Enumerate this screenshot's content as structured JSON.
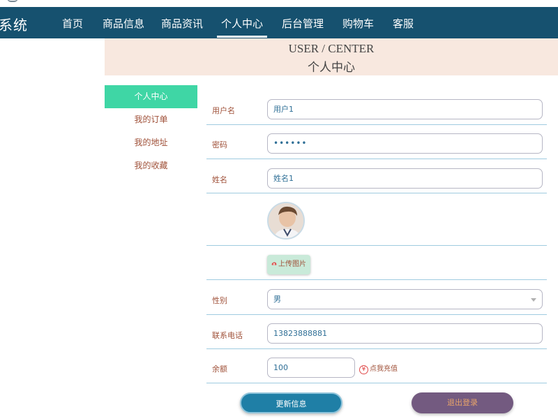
{
  "brand": {
    "title": "系统"
  },
  "nav": {
    "items": [
      {
        "label": "首页"
      },
      {
        "label": "商品信息"
      },
      {
        "label": "商品资讯"
      },
      {
        "label": "个人中心"
      },
      {
        "label": "后台管理"
      },
      {
        "label": "购物车"
      },
      {
        "label": "客服"
      }
    ],
    "active": "个人中心"
  },
  "banner": {
    "en": "USER / CENTER",
    "cn": "个人中心"
  },
  "sidebar": {
    "items": [
      {
        "label": "个人中心"
      },
      {
        "label": "我的订单"
      },
      {
        "label": "我的地址"
      },
      {
        "label": "我的收藏"
      }
    ],
    "active": "个人中心"
  },
  "form": {
    "username": {
      "label": "用户名",
      "value": "用户1"
    },
    "password": {
      "label": "密码",
      "value": "••••••"
    },
    "name": {
      "label": "姓名",
      "value": "姓名1"
    },
    "upload": {
      "label": "上传图片"
    },
    "gender": {
      "label": "性别",
      "value": "男"
    },
    "phone": {
      "label": "联系电话",
      "value": "13823888881"
    },
    "balance": {
      "label": "余额",
      "value": "100",
      "recharge": "点我充值",
      "currency_symbol": "¥"
    }
  },
  "buttons": {
    "update": "更新信息",
    "logout": "退出登录"
  },
  "colors": {
    "navbar": "#16516f",
    "banner": "#f8e8df",
    "sidebar_active": "#3fd6a5",
    "update_button": "#1f7fa6",
    "logout_button": "#735a80"
  }
}
